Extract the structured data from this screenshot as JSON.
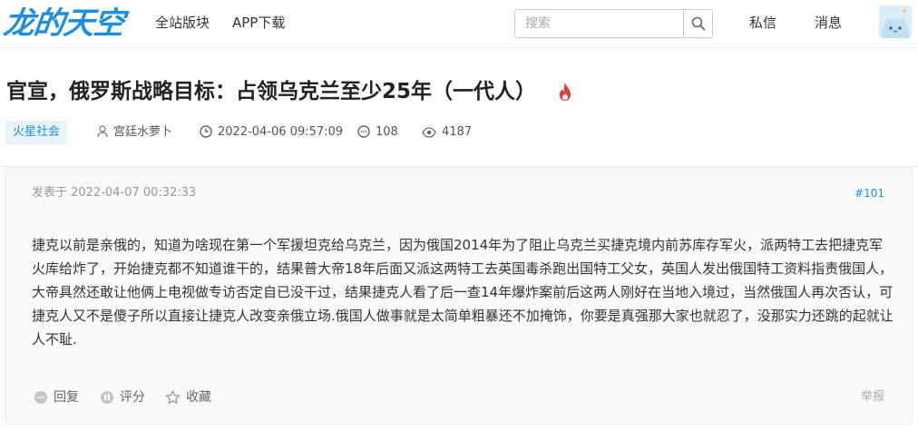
{
  "site": {
    "logo_text": "龙的天空",
    "nav": [
      "全站版块",
      "APP下载"
    ],
    "search_placeholder": "搜索",
    "header_links": [
      "私信",
      "消息"
    ],
    "brand_color": "#1e8fe0"
  },
  "thread": {
    "title": "官宣，俄罗斯战略目标：占领乌克兰至少25年（一代人）",
    "hot_icon": "flame-icon",
    "tag": "火星社会",
    "author": "宫廷水萝卜",
    "time": "2022-04-06 09:57:09",
    "replies": "108",
    "views": "4187"
  },
  "post": {
    "posted_at": "发表于 2022-04-07 00:32:33",
    "floor": "#101",
    "body": "捷克以前是亲俄的，知道为啥现在第一个军援坦克给乌克兰，因为俄国2014年为了阻止乌克兰买捷克境内前苏库存军火，派两特工去把捷克军火库给炸了，开始捷克都不知道谁干的，结果普大帝18年后面又派这两特工去英国毒杀跑出国特工父女，英国人发出俄国特工资料指责俄国人，大帝具然还敢让他俩上电视做专访否定自已没干过，结果捷克人看了后一查14年爆炸案前后这两人刚好在当地入境过，当然俄国人再次否认，可捷克人又不是傻子所以直接让捷克人改变亲俄立场.俄国人做事就是太简单粗暴还不加掩饰，你要是真强那大家也就忍了，没那实力还跳的起就让人不耻.",
    "actions": {
      "reply": "回复",
      "rate": "评分",
      "favorite": "收藏",
      "report": "举报"
    }
  }
}
